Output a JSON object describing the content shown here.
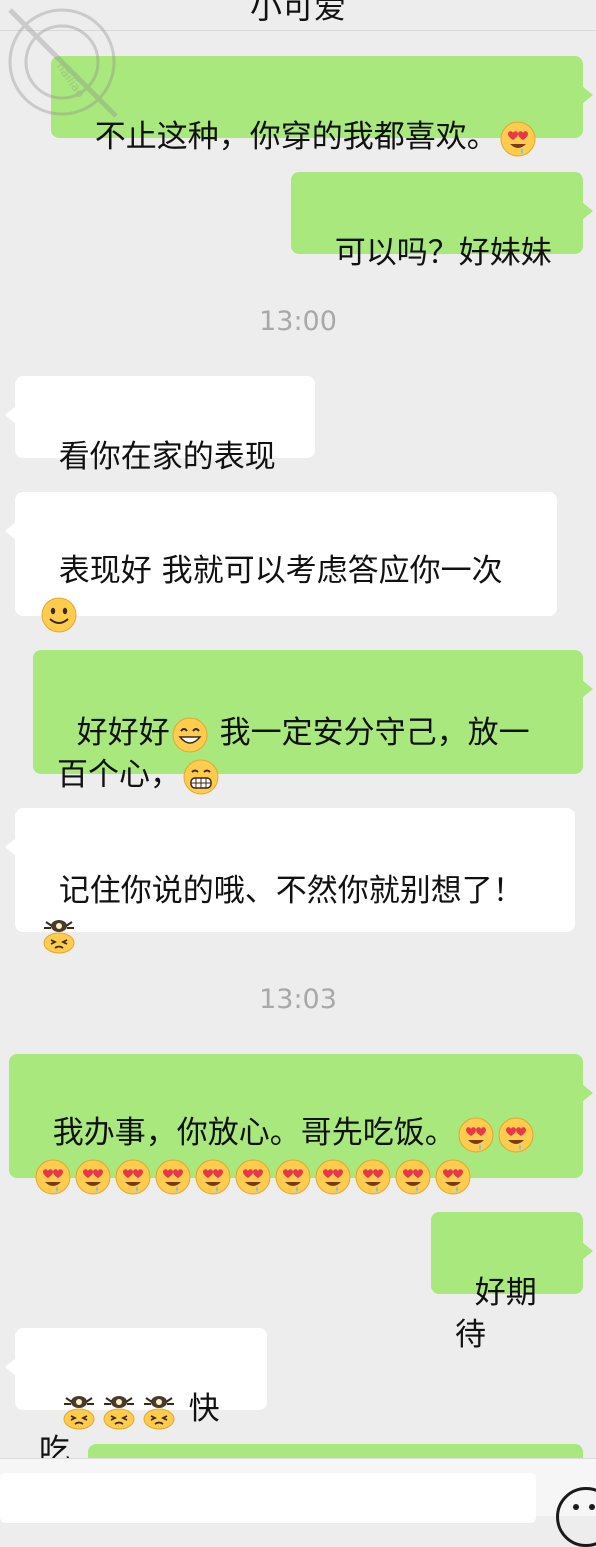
{
  "header": {
    "title": "小可爱"
  },
  "watermark": {
    "text": "hailiao"
  },
  "messages": [
    {
      "id": "m1",
      "from": "self",
      "text": "不止这种，你穿的我都喜欢。",
      "emojis": [
        "heart-eyes"
      ]
    },
    {
      "id": "m2",
      "from": "self",
      "text": "可以吗？好妹妹",
      "emojis": []
    },
    {
      "id": "t1",
      "type": "time",
      "text": "13:00"
    },
    {
      "id": "m3",
      "from": "other",
      "text": "看你在家的表现",
      "emojis": []
    },
    {
      "id": "m4",
      "from": "other",
      "text": "表现好 我就可以考虑答应你一次",
      "emojis": [
        "smile"
      ]
    },
    {
      "id": "m5",
      "from": "self",
      "text_a": "好好好",
      "text_b": " 我一定安分守己，放一百个心，",
      "emojis": [
        "grin",
        "big-grin"
      ]
    },
    {
      "id": "m6",
      "from": "other",
      "text": "记住你说的哦、不然你就别想了！",
      "emojis": [
        "angry-pig"
      ]
    },
    {
      "id": "t2",
      "type": "time",
      "text": "13:03"
    },
    {
      "id": "m7",
      "from": "self",
      "text": "我办事，你放心。哥先吃饭。",
      "emoji_count": 13,
      "emoji": "heart-eyes"
    },
    {
      "id": "m8",
      "from": "self",
      "text": "好期待",
      "emojis": []
    },
    {
      "id": "m9",
      "from": "other",
      "text": "快吃",
      "emoji_count": 3,
      "emoji": "angry-pig"
    }
  ],
  "colors": {
    "self_bubble": "#a9e87d",
    "other_bubble": "#ffffff",
    "background": "#ededed",
    "timestamp": "#a8a8a8"
  }
}
